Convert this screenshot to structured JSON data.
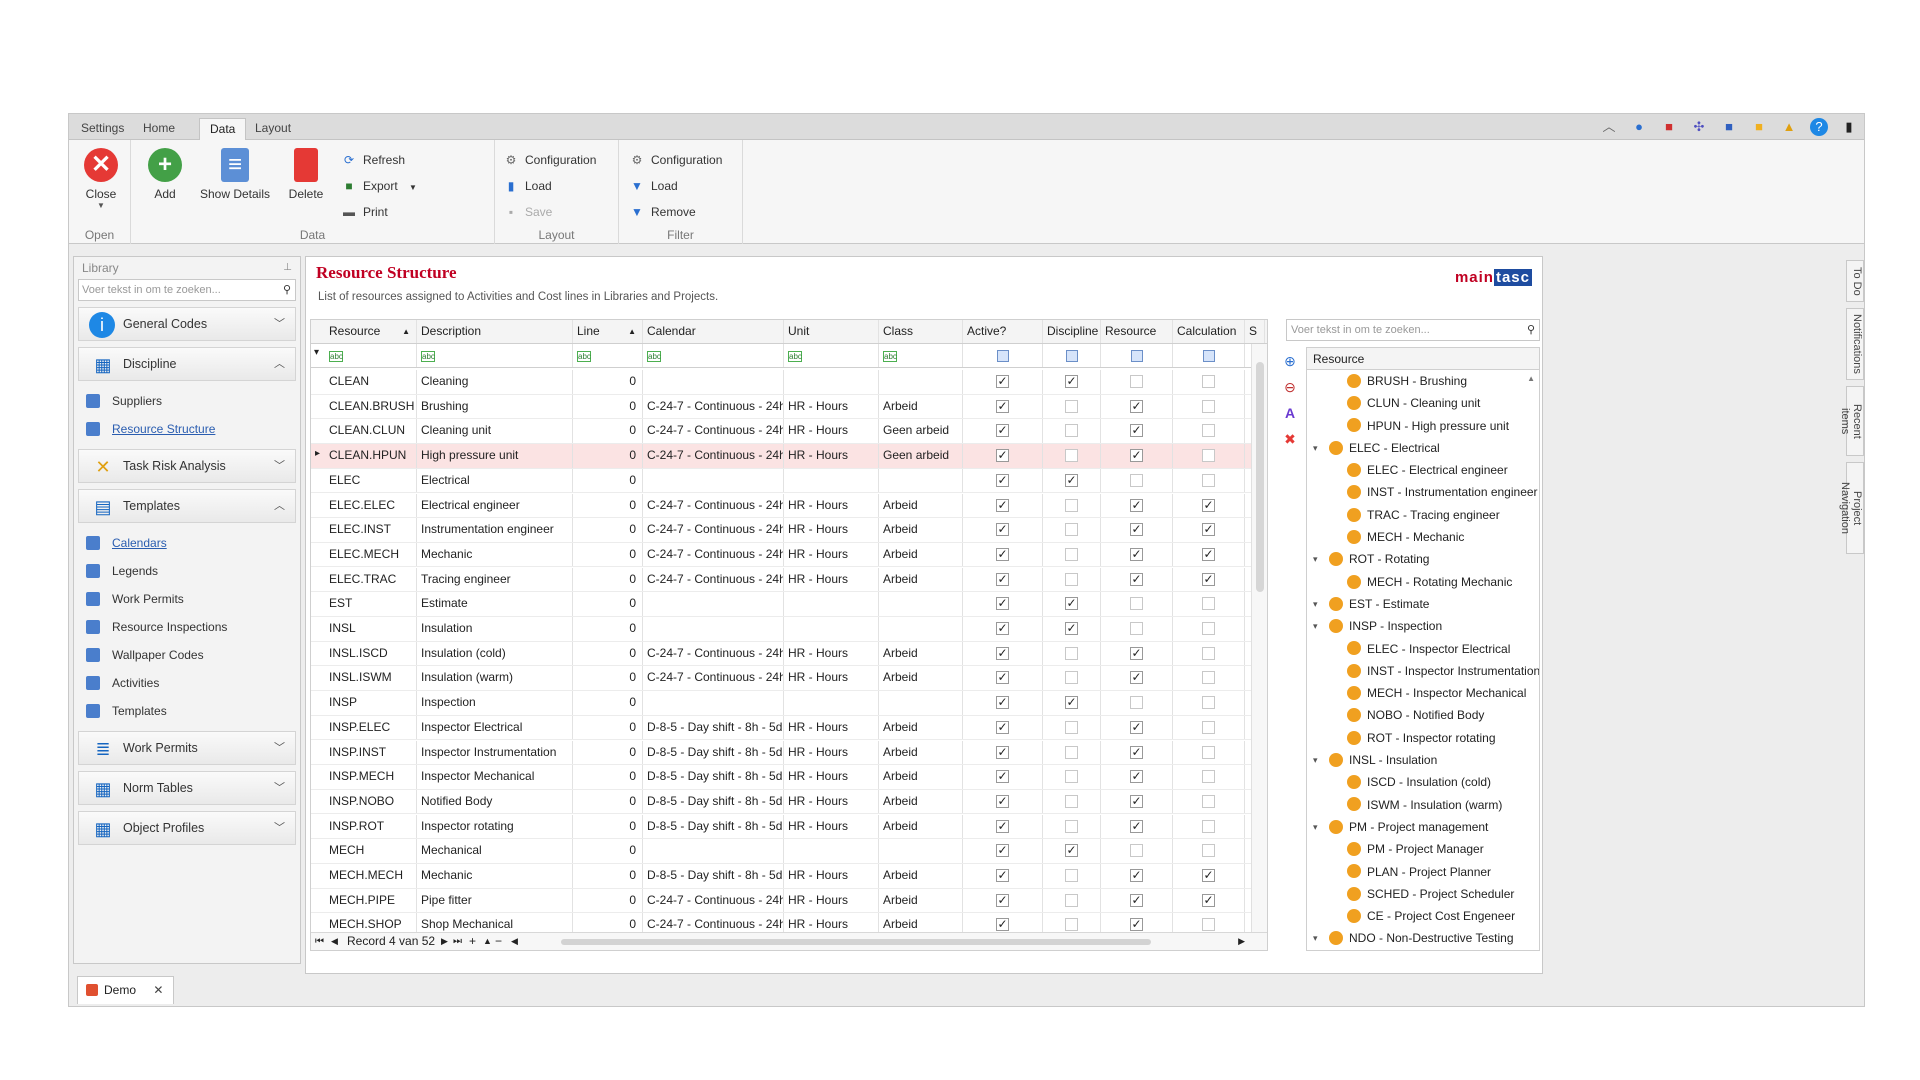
{
  "ribbon_tabs": [
    "Settings",
    "Home",
    "Data",
    "Layout"
  ],
  "active_tab": "Data",
  "ribbon": {
    "open": {
      "label": "Open",
      "close": "Close"
    },
    "data": {
      "label": "Data",
      "add": "Add",
      "show_details": "Show Details",
      "delete": "Delete",
      "refresh": "Refresh",
      "export": "Export",
      "print": "Print"
    },
    "layout": {
      "label": "Layout",
      "configuration": "Configuration",
      "load": "Load",
      "save": "Save"
    },
    "filter": {
      "label": "Filter",
      "configuration": "Configuration",
      "load": "Load",
      "remove": "Remove"
    }
  },
  "library": {
    "title": "Library",
    "search_placeholder": "Voer tekst in om te zoeken...",
    "categories": [
      {
        "label": "General Codes",
        "icon": "info-icon",
        "expanded": false,
        "items": []
      },
      {
        "label": "Discipline",
        "icon": "grid-icon",
        "expanded": true,
        "items": [
          {
            "label": "Suppliers",
            "link": false
          },
          {
            "label": "Resource Structure",
            "link": true
          }
        ]
      },
      {
        "label": "Task Risk Analysis",
        "icon": "risk-icon",
        "expanded": false,
        "items": []
      },
      {
        "label": "Templates",
        "icon": "templates-icon",
        "expanded": true,
        "items": [
          {
            "label": "Calendars",
            "link": true
          },
          {
            "label": "Legends",
            "link": false
          },
          {
            "label": "Work Permits",
            "link": false
          },
          {
            "label": "Resource Inspections",
            "link": false
          },
          {
            "label": "Wallpaper Codes",
            "link": false
          },
          {
            "label": "Activities",
            "link": false
          },
          {
            "label": "Templates",
            "link": false
          }
        ]
      },
      {
        "label": "Work Permits",
        "icon": "permits-icon",
        "expanded": false,
        "items": []
      },
      {
        "label": "Norm Tables",
        "icon": "calculator-icon",
        "expanded": false,
        "items": []
      },
      {
        "label": "Object Profiles",
        "icon": "profiles-icon",
        "expanded": false,
        "items": []
      }
    ]
  },
  "main": {
    "title": "Resource Structure",
    "subtitle": "List of resources assigned to Activities and Cost lines in Libraries and Projects.",
    "logo_a": "main",
    "logo_b": "tasc"
  },
  "grid": {
    "columns": [
      "Resource",
      "Description",
      "Line",
      "Calendar",
      "Unit",
      "Class",
      "Active?",
      "Discipline",
      "Resource",
      "Calculation",
      "S"
    ],
    "rows": [
      [
        "CLEAN",
        "Cleaning",
        "0",
        "",
        "",
        "",
        1,
        1,
        0,
        0
      ],
      [
        "CLEAN.BRUSH",
        "Brushing",
        "0",
        "C-24-7 - Continuous - 24h ...",
        "HR - Hours",
        "Arbeid",
        1,
        0,
        1,
        0
      ],
      [
        "CLEAN.CLUN",
        "Cleaning unit",
        "0",
        "C-24-7 - Continuous - 24h ...",
        "HR - Hours",
        "Geen arbeid",
        1,
        0,
        1,
        0
      ],
      [
        "CLEAN.HPUN",
        "High pressure unit",
        "0",
        "C-24-7 - Continuous - 24h ...",
        "HR - Hours",
        "Geen arbeid",
        1,
        0,
        1,
        0
      ],
      [
        "ELEC",
        "Electrical",
        "0",
        "",
        "",
        "",
        1,
        1,
        0,
        0
      ],
      [
        "ELEC.ELEC",
        "Electrical engineer",
        "0",
        "C-24-7 - Continuous - 24h ...",
        "HR - Hours",
        "Arbeid",
        1,
        0,
        1,
        1
      ],
      [
        "ELEC.INST",
        "Instrumentation engineer",
        "0",
        "C-24-7 - Continuous - 24h ...",
        "HR - Hours",
        "Arbeid",
        1,
        0,
        1,
        1
      ],
      [
        "ELEC.MECH",
        "Mechanic",
        "0",
        "C-24-7 - Continuous - 24h ...",
        "HR - Hours",
        "Arbeid",
        1,
        0,
        1,
        1
      ],
      [
        "ELEC.TRAC",
        "Tracing engineer",
        "0",
        "C-24-7 - Continuous - 24h ...",
        "HR - Hours",
        "Arbeid",
        1,
        0,
        1,
        1
      ],
      [
        "EST",
        "Estimate",
        "0",
        "",
        "",
        "",
        1,
        1,
        0,
        0
      ],
      [
        "INSL",
        "Insulation",
        "0",
        "",
        "",
        "",
        1,
        1,
        0,
        0
      ],
      [
        "INSL.ISCD",
        "Insulation (cold)",
        "0",
        "C-24-7 - Continuous - 24h ...",
        "HR - Hours",
        "Arbeid",
        1,
        0,
        1,
        0
      ],
      [
        "INSL.ISWM",
        "Insulation (warm)",
        "0",
        "C-24-7 - Continuous - 24h ...",
        "HR - Hours",
        "Arbeid",
        1,
        0,
        1,
        0
      ],
      [
        "INSP",
        "Inspection",
        "0",
        "",
        "",
        "",
        1,
        1,
        0,
        0
      ],
      [
        "INSP.ELEC",
        "Inspector Electrical",
        "0",
        "D-8-5 - Day shift - 8h - 5d",
        "HR - Hours",
        "Arbeid",
        1,
        0,
        1,
        0
      ],
      [
        "INSP.INST",
        "Inspector Instrumentation",
        "0",
        "D-8-5 - Day shift - 8h - 5d",
        "HR - Hours",
        "Arbeid",
        1,
        0,
        1,
        0
      ],
      [
        "INSP.MECH",
        "Inspector Mechanical",
        "0",
        "D-8-5 - Day shift - 8h - 5d",
        "HR - Hours",
        "Arbeid",
        1,
        0,
        1,
        0
      ],
      [
        "INSP.NOBO",
        "Notified Body",
        "0",
        "D-8-5 - Day shift - 8h - 5d",
        "HR - Hours",
        "Arbeid",
        1,
        0,
        1,
        0
      ],
      [
        "INSP.ROT",
        "Inspector rotating",
        "0",
        "D-8-5 - Day shift - 8h - 5d",
        "HR - Hours",
        "Arbeid",
        1,
        0,
        1,
        0
      ],
      [
        "MECH",
        "Mechanical",
        "0",
        "",
        "",
        "",
        1,
        1,
        0,
        0
      ],
      [
        "MECH.MECH",
        "Mechanic",
        "0",
        "D-8-5 - Day shift - 8h - 5d",
        "HR - Hours",
        "Arbeid",
        1,
        0,
        1,
        1
      ],
      [
        "MECH.PIPE",
        "Pipe fitter",
        "0",
        "C-24-7 - Continuous - 24h ...",
        "HR - Hours",
        "Arbeid",
        1,
        0,
        1,
        1
      ],
      [
        "MECH.SHOP",
        "Shop Mechanical",
        "0",
        "C-24-7 - Continuous - 24h ...",
        "HR - Hours",
        "Arbeid",
        1,
        0,
        1,
        0
      ]
    ],
    "selected_row": 3,
    "record_text": "Record 4 van 52"
  },
  "side": {
    "search_placeholder": "Voer tekst in om te zoeken...",
    "tree_header": "Resource",
    "tree": [
      {
        "label": "BRUSH - Brushing",
        "level": 1
      },
      {
        "label": "CLUN - Cleaning unit",
        "level": 1
      },
      {
        "label": "HPUN - High pressure unit",
        "level": 1
      },
      {
        "label": "ELEC - Electrical",
        "level": 0
      },
      {
        "label": "ELEC - Electrical engineer",
        "level": 1
      },
      {
        "label": "INST - Instrumentation engineer",
        "level": 1
      },
      {
        "label": "TRAC - Tracing engineer",
        "level": 1
      },
      {
        "label": "MECH - Mechanic",
        "level": 1
      },
      {
        "label": "ROT - Rotating",
        "level": 0
      },
      {
        "label": "MECH - Rotating Mechanic",
        "level": 1
      },
      {
        "label": "EST - Estimate",
        "level": 0
      },
      {
        "label": "INSP - Inspection",
        "level": 0
      },
      {
        "label": "ELEC - Inspector Electrical",
        "level": 1
      },
      {
        "label": "INST - Inspector Instrumentation",
        "level": 1
      },
      {
        "label": "MECH - Inspector Mechanical",
        "level": 1
      },
      {
        "label": "NOBO - Notified Body",
        "level": 1
      },
      {
        "label": "ROT - Inspector rotating",
        "level": 1
      },
      {
        "label": "INSL - Insulation",
        "level": 0
      },
      {
        "label": "ISCD - Insulation (cold)",
        "level": 1
      },
      {
        "label": "ISWM - Insulation (warm)",
        "level": 1
      },
      {
        "label": "PM - Project management",
        "level": 0
      },
      {
        "label": "PM - Project Manager",
        "level": 1
      },
      {
        "label": "PLAN - Project Planner",
        "level": 1
      },
      {
        "label": "SCHED - Project Scheduler",
        "level": 1
      },
      {
        "label": "CE - Project Cost Engeneer",
        "level": 1
      },
      {
        "label": "NDO - Non-Destructive Testing",
        "level": 0
      }
    ]
  },
  "right_tabs": [
    "To Do",
    "Notifications",
    "Recent items",
    "Project Navigation"
  ],
  "doc_tab": "Demo",
  "colors": {
    "accent_red": "#c00022",
    "selection": "#fbe3e3",
    "link": "#2a5db0"
  }
}
